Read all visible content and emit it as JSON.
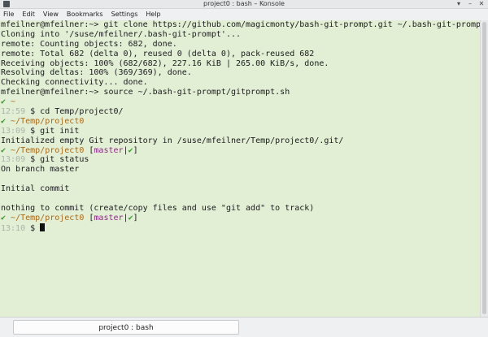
{
  "window": {
    "title": "project0 : bash – Konsole",
    "buttons": [
      "▾",
      "–",
      "✕"
    ]
  },
  "menu": [
    "File",
    "Edit",
    "View",
    "Bookmarks",
    "Settings",
    "Help"
  ],
  "terminal": {
    "lines": [
      [
        {
          "t": "mfeilner@mfeilner:~> git clone https://github.com/magicmonty/bash-git-prompt.git ~/.bash-git-prompt"
        }
      ],
      [
        {
          "t": "Cloning into '/suse/mfeilner/.bash-git-prompt'..."
        }
      ],
      [
        {
          "t": "remote: Counting objects: 682, done."
        }
      ],
      [
        {
          "t": "remote: Total 682 (delta 0), reused 0 (delta 0), pack-reused 682"
        }
      ],
      [
        {
          "t": "Receiving objects: 100% (682/682), 227.16 KiB | 265.00 KiB/s, done."
        }
      ],
      [
        {
          "t": "Resolving deltas: 100% (369/369), done."
        }
      ],
      [
        {
          "t": "Checking connectivity... done."
        }
      ],
      [
        {
          "t": "mfeilner@mfeilner:~> source ~/.bash-git-prompt/gitprompt.sh"
        }
      ],
      [
        {
          "t": "✔ ",
          "c": "ok"
        },
        {
          "t": "~",
          "c": "path"
        }
      ],
      [
        {
          "t": "12:59",
          "c": "time"
        },
        {
          "t": " $ cd Temp/project0/"
        }
      ],
      [
        {
          "t": "✔ ",
          "c": "ok"
        },
        {
          "t": "~/Temp/project0",
          "c": "path"
        }
      ],
      [
        {
          "t": "13:09",
          "c": "time"
        },
        {
          "t": " $ git init"
        }
      ],
      [
        {
          "t": "Initialized empty Git repository in /suse/mfeilner/Temp/project0/.git/"
        }
      ],
      [
        {
          "t": "✔ ",
          "c": "ok"
        },
        {
          "t": "~/Temp/project0",
          "c": "path"
        },
        {
          "t": " ["
        },
        {
          "t": "master",
          "c": "branch"
        },
        {
          "t": "|"
        },
        {
          "t": "✔",
          "c": "ok"
        },
        {
          "t": "]"
        }
      ],
      [
        {
          "t": "13:09",
          "c": "time"
        },
        {
          "t": " $ git status"
        }
      ],
      [
        {
          "t": "On branch master"
        }
      ],
      [
        {
          "t": ""
        }
      ],
      [
        {
          "t": "Initial commit"
        }
      ],
      [
        {
          "t": ""
        }
      ],
      [
        {
          "t": "nothing to commit (create/copy files and use \"git add\" to track)"
        }
      ],
      [
        {
          "t": "✔ ",
          "c": "ok"
        },
        {
          "t": "~/Temp/project0",
          "c": "path"
        },
        {
          "t": " ["
        },
        {
          "t": "master",
          "c": "branch"
        },
        {
          "t": "|"
        },
        {
          "t": "✔",
          "c": "ok"
        },
        {
          "t": "]"
        }
      ],
      [
        {
          "t": "13:10",
          "c": "time"
        },
        {
          "t": " $ "
        },
        {
          "t": "",
          "c": "cursor"
        }
      ]
    ]
  },
  "tab": {
    "label": "project0 : bash"
  },
  "colors": {
    "terminal_bg": "#e2efd5",
    "ok_green": "#3b9a2d",
    "path_orange": "#a86a16",
    "branch_magenta": "#8c2b86",
    "time_gray": "#aeb3ab"
  },
  "icons": {
    "app": "konsole-icon",
    "menu": "chevron-down-icon",
    "minimize": "minimize-icon",
    "close": "close-icon"
  }
}
